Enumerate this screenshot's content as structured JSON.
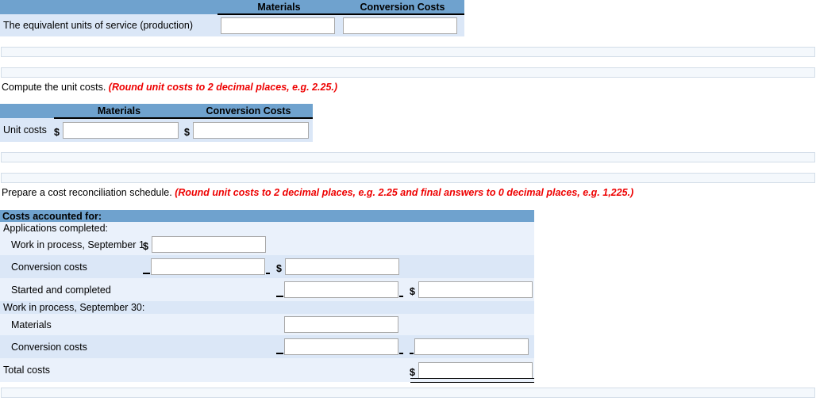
{
  "equivalent_units": {
    "columns": [
      "Materials",
      "Conversion Costs"
    ],
    "row_label": "The equivalent units of service (production)",
    "materials_value": "",
    "conversion_value": "",
    "placeholder": ""
  },
  "unit_costs_prompt": {
    "text": "Compute the unit costs. ",
    "hint": "(Round unit costs to 2 decimal places, e.g. 2.25.)"
  },
  "unit_costs": {
    "columns": [
      "Materials",
      "Conversion Costs"
    ],
    "row_label": "Unit costs",
    "currency": "$",
    "materials_value": "",
    "conversion_value": ""
  },
  "reconciliation_prompt": {
    "text": "Prepare a cost reconciliation schedule. ",
    "hint": "(Round unit costs to 2 decimal places, e.g. 2.25 and final answers to 0 decimal places, e.g. 1,225.)"
  },
  "reconciliation": {
    "title": "Costs accounted for:",
    "currency": "$",
    "rows": [
      {
        "label": "Applications completed:",
        "indent": 0
      },
      {
        "label": "Work in process, September 1",
        "indent": 1,
        "col1": ""
      },
      {
        "label": "Conversion costs",
        "indent": 1,
        "col1": "",
        "col2": ""
      },
      {
        "label": "Started and completed",
        "indent": 1,
        "col2": "",
        "col3": ""
      },
      {
        "label": "Work in process, September 30:",
        "indent": 0
      },
      {
        "label": "Materials",
        "indent": 1,
        "col2": ""
      },
      {
        "label": "Conversion costs",
        "indent": 1,
        "col2": "",
        "col3": ""
      },
      {
        "label": "Total costs",
        "indent": 0,
        "col3": ""
      }
    ]
  },
  "colors": {
    "header_blue": "#6fa2ce",
    "row_light": "#eaf1fb",
    "row_dark": "#dbe7f7",
    "hint_red": "#ee0000",
    "strip_fill": "#f4f8fc",
    "strip_border": "#d3dde8",
    "field_border": "#a9a9a9"
  }
}
